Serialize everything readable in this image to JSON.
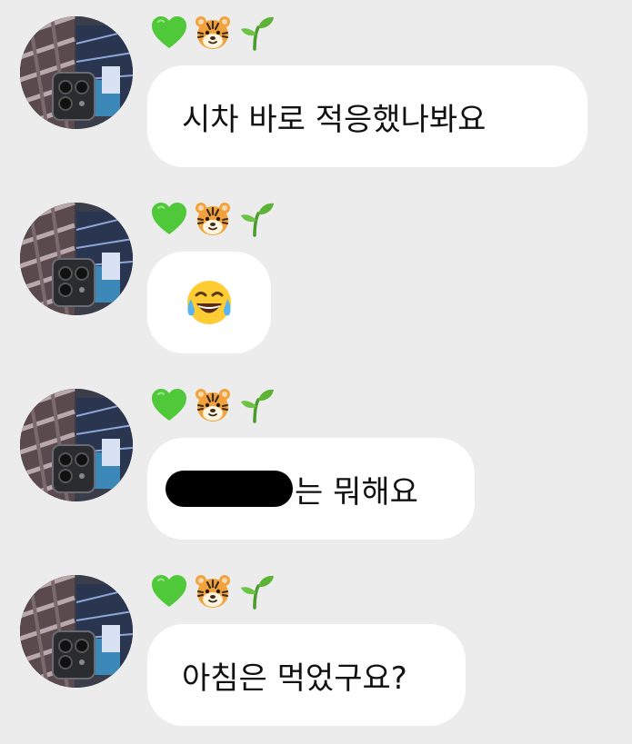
{
  "sender": {
    "badges": [
      {
        "icon": "green-heart-icon",
        "color": "#4fc93a"
      },
      {
        "icon": "tiger-face-icon",
        "color": "#f2a23c"
      },
      {
        "icon": "seedling-icon",
        "color": "#5cb336"
      }
    ]
  },
  "messages": [
    {
      "type": "text",
      "text": "시차 바로 적응했나봐요"
    },
    {
      "type": "emoji",
      "icon": "face-with-tears-of-joy-icon"
    },
    {
      "type": "text",
      "redacted_prefix": true,
      "text": "는 뭐해요"
    },
    {
      "type": "text",
      "text": "아침은 먹었구요?"
    }
  ],
  "colors": {
    "background": "#ececec",
    "bubble": "#ffffff",
    "text": "#111111",
    "redaction": "#000000"
  }
}
